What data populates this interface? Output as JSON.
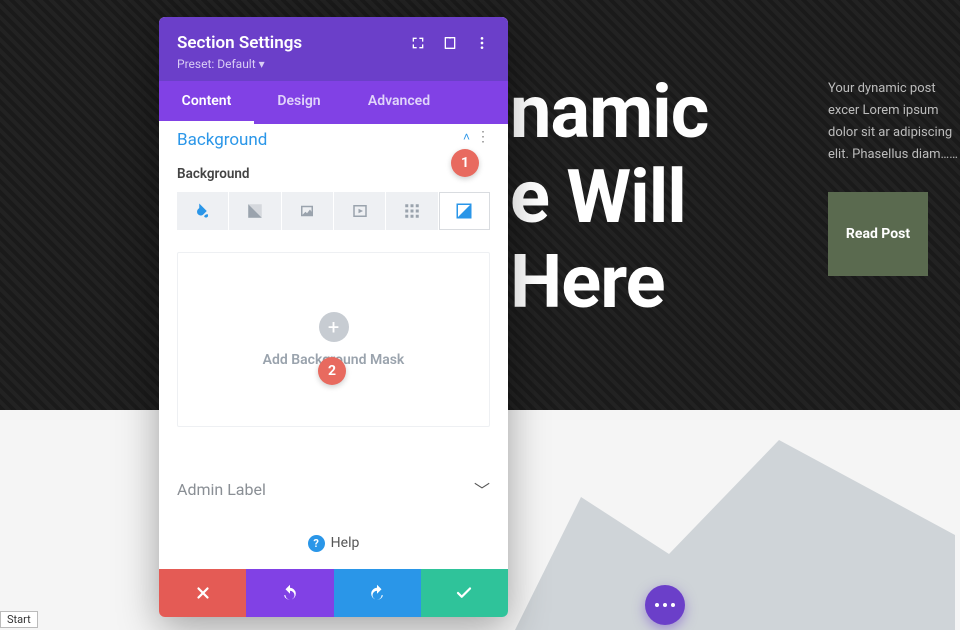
{
  "hero": {
    "title_lines": [
      "namic",
      "e Will",
      "Here"
    ],
    "excerpt": "Your dynamic post excer Lorem ipsum dolor sit ar adipiscing elit. Phasellus diam……",
    "read_post": "Read Post"
  },
  "panel": {
    "title": "Section Settings",
    "preset": "Preset: Default ▾",
    "tabs": {
      "content": "Content",
      "design": "Design",
      "advanced": "Advanced",
      "active": "content"
    },
    "section_title": "Background",
    "field_label": "Background",
    "dropzone_label": "Add Background Mask",
    "admin_label": "Admin Label",
    "help_label": "Help"
  },
  "callouts": {
    "one": "1",
    "two": "2"
  },
  "misc": {
    "start": "Start"
  }
}
